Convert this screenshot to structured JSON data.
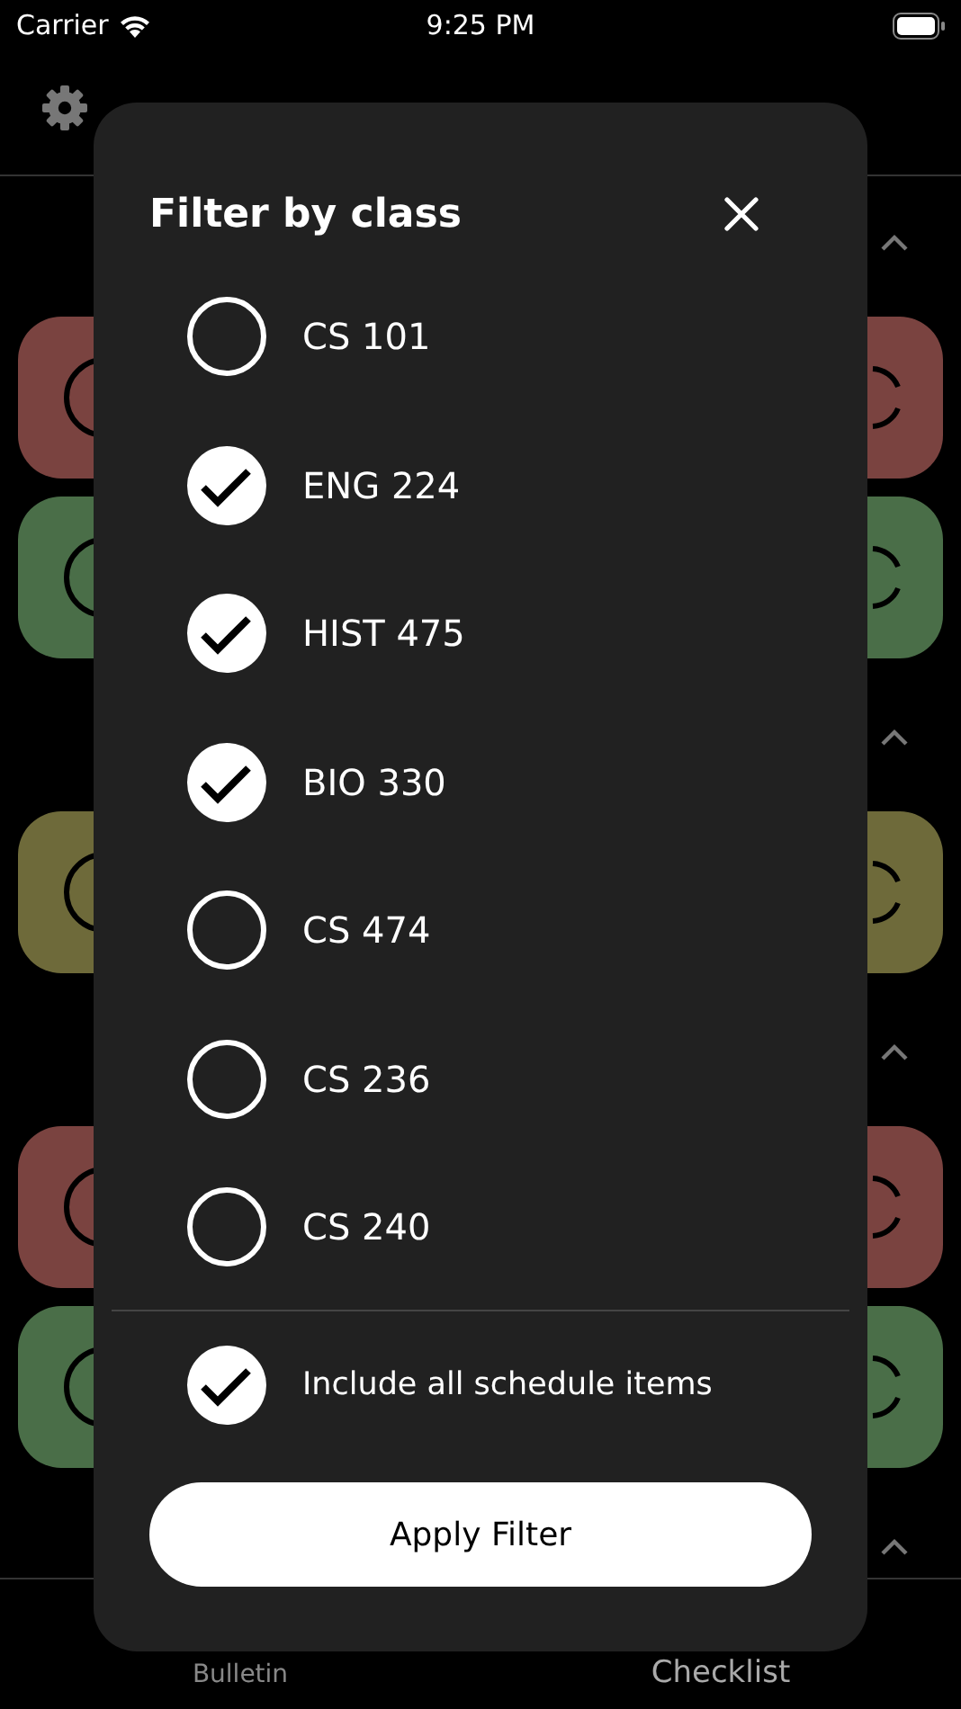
{
  "status_bar": {
    "carrier": "Carrier",
    "time": "9:25 PM"
  },
  "sections": [
    {
      "expanded": true,
      "cards": [
        {
          "color": "#7a4340"
        },
        {
          "color": "#4a6e48"
        }
      ]
    },
    {
      "expanded": true,
      "cards": [
        {
          "color": "#6e6a3a"
        }
      ]
    },
    {
      "expanded": true,
      "cards": [
        {
          "color": "#7a4340"
        },
        {
          "color": "#4a6e48"
        }
      ]
    },
    {
      "expanded": true
    }
  ],
  "tab_bar": {
    "items": [
      {
        "label": "Bulletin",
        "selected": false
      },
      {
        "label": "Checklist",
        "selected": true
      }
    ]
  },
  "dialog": {
    "title": "Filter by class",
    "options": [
      {
        "label": "CS 101",
        "checked": false
      },
      {
        "label": "ENG 224",
        "checked": true
      },
      {
        "label": "HIST 475",
        "checked": true
      },
      {
        "label": "BIO 330",
        "checked": true
      },
      {
        "label": "CS 474",
        "checked": false
      },
      {
        "label": "CS 236",
        "checked": false
      },
      {
        "label": "CS 240",
        "checked": false
      }
    ],
    "include_all": {
      "label": "Include all schedule items",
      "checked": true
    },
    "apply_button": "Apply Filter"
  }
}
